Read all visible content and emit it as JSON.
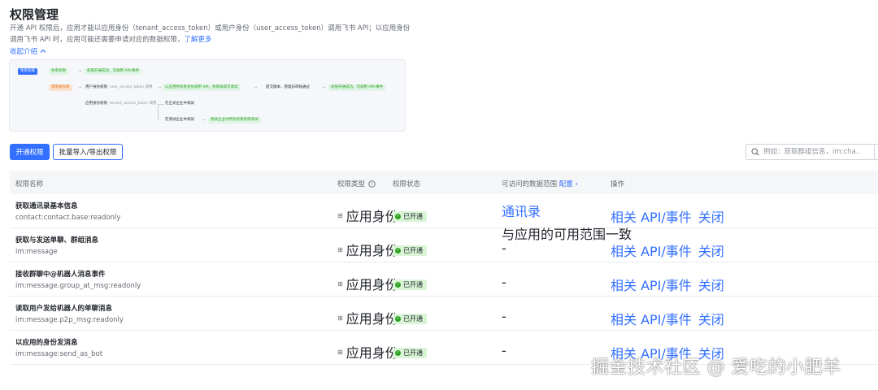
{
  "page": {
    "title": "权限管理",
    "description": "开通 API 权限后，应用才能以应用身份（tenant_access_token）或用户身份（user_access_token）调用飞书 API；以应用身份调用飞书 API 时，应用可能还需要申请对应的数据权限，",
    "learn_more": "了解更多",
    "collapse": "收起介绍"
  },
  "flow": {
    "node_free": "免审权限",
    "node_free_result": "权限开通成功，可调用 API/事件",
    "node_review": "需审核权限",
    "node_user_identity": "用户身份权限",
    "node_user_token": "user_access_token 调用",
    "node_user_result": "以应用所有者身份调用 API，免审核即可调试",
    "node_submit": "提交版本，管理员审核通过",
    "node_final": "权限开通成功，可调用 API/事件",
    "node_app_identity": "应用身份权限",
    "node_app_token": "tenant_access_token 调用",
    "node_prod": "在正式企业中调试",
    "node_test": "在测试企业中调试",
    "node_test_result": "测试企业中所有权限免审调试"
  },
  "toolbar": {
    "enable_button": "开通权限",
    "batch_button": "批量导入/导出权限",
    "search_placeholder": "例如：获取群组信息，im:cha..."
  },
  "table": {
    "headers": {
      "name": "权限名称",
      "type": "权限类型",
      "status": "权限状态",
      "scope": "可访问的数据范围",
      "config": "配置",
      "ops": "操作"
    },
    "rows": [
      {
        "title": "获取通讯录基本信息",
        "code": "contact:contact.base:readonly",
        "type": "应用身份",
        "status": "已开通",
        "scope_link": "通讯录",
        "scope_text": "与应用的可用范围一致",
        "op_api": "相关 API/事件",
        "op_close": "关闭"
      },
      {
        "title": "获取与发送单聊、群组消息",
        "code": "im:message",
        "type": "应用身份",
        "status": "已开通",
        "scope_text": "-",
        "op_api": "相关 API/事件",
        "op_close": "关闭"
      },
      {
        "title": "接收群聊中@机器人消息事件",
        "code": "im:message.group_at_msg:readonly",
        "type": "应用身份",
        "status": "已开通",
        "scope_text": "-",
        "op_api": "相关 API/事件",
        "op_close": "关闭"
      },
      {
        "title": "读取用户发给机器人的单聊消息",
        "code": "im:message.p2p_msg:readonly",
        "type": "应用身份",
        "status": "已开通",
        "scope_text": "-",
        "op_api": "相关 API/事件",
        "op_close": "关闭"
      },
      {
        "title": "以应用的身份发消息",
        "code": "im:message:send_as_bot",
        "type": "应用身份",
        "status": "已开通",
        "scope_text": "-",
        "op_api": "相关 API/事件",
        "op_close": "关闭"
      }
    ]
  },
  "watermark": "掘金技术社区 @ 爱吃的小肥羊",
  "colors": {
    "accent": "#3370ff",
    "success": "#2ea121",
    "success_bg": "#d9f5d6"
  }
}
